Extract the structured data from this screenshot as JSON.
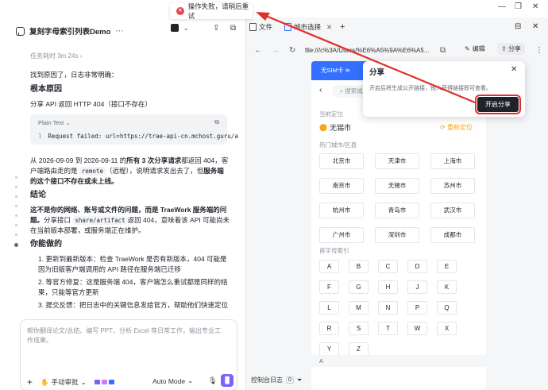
{
  "toast": {
    "text": "操作失败，请稍后重试"
  },
  "chat": {
    "title": "复刻字母索引列表Demo",
    "more": "⋯",
    "task_time": "任务耗时 3m 24s",
    "intro": "找到原因了，日志非常明确：",
    "root_cause_heading": "根本原因",
    "root_cause_text": "分享 API 返回 HTTP 404（接口不存在）",
    "code": {
      "lang": "Plain Text",
      "line_no": "1",
      "line": "Request failed: url=https://trae-api-cn.mchost.guru/a"
    },
    "para1_a": "从 2026-09-09 到 2026-09-11 的",
    "para1_b": "所有 3 次分享请求",
    "para1_c": "都返回 404，客户端路由走的是",
    "para1_code": "remote",
    "para1_d": "（远程），说明请求发出去了，但",
    "para1_e": "服务端的这个接口不存在或未上线。",
    "conclusion_heading": "结论",
    "conclusion_a": "这不是你的网络、账号或文件的问题，而是 TraeWork 服务端的问题。",
    "conclusion_b": "分享接口",
    "conclusion_code": "share/artifact",
    "conclusion_c": "返回 404，意味着该 API 可能尚未在当前版本部署，或服务端正在维护。",
    "todo_heading": "你能做的",
    "steps": [
      "1. 更新到最新版本：检查 TraeWork 是否有新版本，404 可能是因为旧版客户端调用的 API 路径在服务端已迁移",
      "2. 等官方修复：这是服务端 404，客户端怎么重试都是同样的结果，只能等官方更新",
      "3. 提交反馈：把日志中的关键信息发给官方，帮助他们快速定位"
    ],
    "composer_placeholder": "帮你翻译论文/总结、编写 PPT、分析 Excel 等日常工作，输出专业工作成果。",
    "manual_label": "手动审批",
    "auto_mode": "Auto Mode"
  },
  "browser": {
    "tabs": [
      "文件",
      "城市选择"
    ],
    "url": "file:///c%3A/Users/%E6%A5%9A%E6%A5...",
    "edit_label": "编辑",
    "share_label": "分享",
    "console_label": "控制台日志",
    "console_count": "0"
  },
  "phone": {
    "status": "无SIM卡",
    "search_placeholder": "搜索城市",
    "current_label": "当前定位",
    "current_city": "无锡市",
    "relocate": "重新定位",
    "hot_label": "热门城市/区县",
    "hot_cities": [
      "北京市",
      "天津市",
      "上海市",
      "南京市",
      "无锡市",
      "苏州市",
      "杭州市",
      "青岛市",
      "武汉市",
      "广州市",
      "深圳市",
      "成都市"
    ],
    "index_label": "首字母索引",
    "letters": [
      "A",
      "B",
      "C",
      "D",
      "E",
      "F",
      "G",
      "H",
      "J",
      "K",
      "L",
      "M",
      "N",
      "P",
      "Q",
      "R",
      "S",
      "T",
      "W",
      "X",
      "Y",
      "Z"
    ],
    "index_a": "A"
  },
  "popup": {
    "title": "分享",
    "close": "✕",
    "desc": "开启后将生成公开链接，他人获得链接即可查看。",
    "button": "开启分享"
  },
  "colors": {
    "accent": "#3370ff",
    "error": "#e5484d",
    "annotation": "#e0302b",
    "send": "#7b61ff"
  }
}
